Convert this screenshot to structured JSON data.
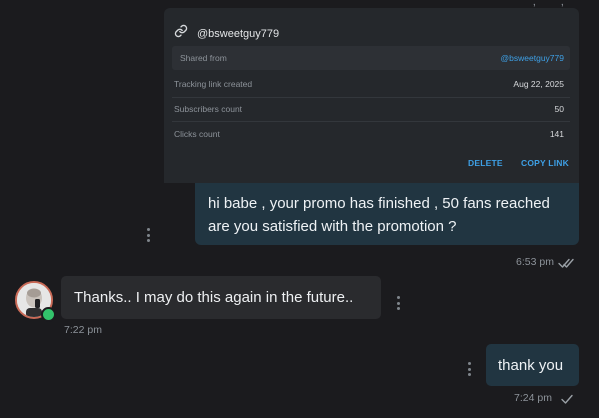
{
  "promo_card": {
    "username": "@bsweetguy779",
    "rows": [
      {
        "label": "Shared from",
        "value": "@bsweetguy779"
      },
      {
        "label": "Tracking link created",
        "value": "Aug 22, 2025"
      },
      {
        "label": "Subscribers count",
        "value": "50"
      },
      {
        "label": "Clicks count",
        "value": "141"
      }
    ],
    "actions": {
      "delete": "DELETE",
      "copy_link": "COPY LINK"
    }
  },
  "messages": [
    {
      "direction": "outgoing",
      "lines": [
        "hi babe , your promo has finished , 50 fans reached",
        "are you satisfied with the promotion ?"
      ],
      "time": "6:53 pm",
      "status": "read"
    },
    {
      "direction": "incoming",
      "text": "Thanks.. I may do this again in the future..",
      "time": "7:22 pm"
    },
    {
      "direction": "outgoing",
      "text": "thank you",
      "time": "7:24 pm",
      "status": "sent"
    }
  ],
  "colors": {
    "accent": "#3ea0e6",
    "outgoing_bubble": "#213541",
    "incoming_bubble": "#2a2b2e",
    "online": "#33c26b"
  },
  "icons": [
    "link-icon",
    "kebab-menu-icon",
    "double-check-icon",
    "single-check-icon",
    "online-status-dot"
  ]
}
